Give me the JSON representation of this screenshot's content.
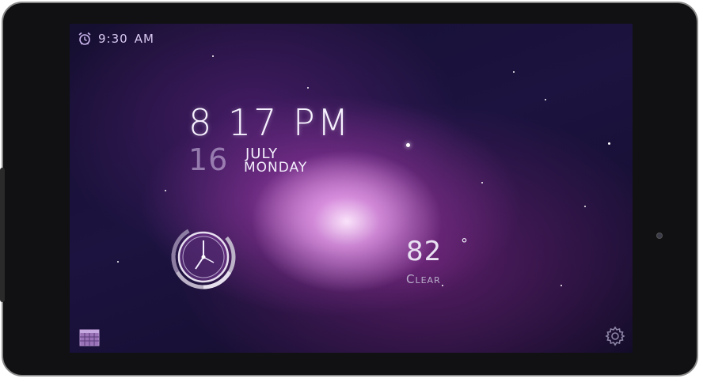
{
  "status_bar": {
    "alarm_icon": "alarm-clock-icon",
    "alarm_time": "9:30",
    "alarm_period": "AM"
  },
  "clock": {
    "time": "8 17 PM",
    "day": "16",
    "month": "JULY",
    "weekday": "MONDAY",
    "analog_icon": "analog-clock-icon"
  },
  "weather": {
    "temperature": "82",
    "degree_symbol": "°",
    "condition": "Clear"
  },
  "bottom_bar": {
    "calendar_icon": "calendar-grid-icon",
    "settings_icon": "gear-icon"
  },
  "colors": {
    "accent_purple": "#a070c8",
    "text_light": "#f7f2ff"
  }
}
